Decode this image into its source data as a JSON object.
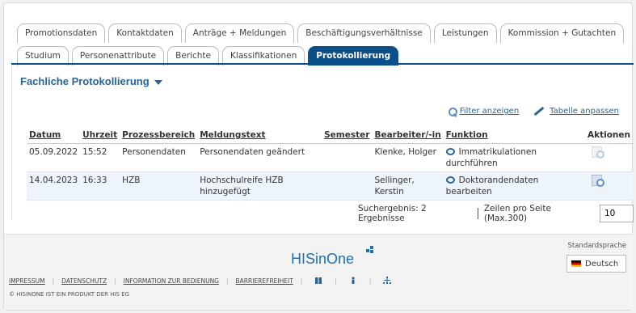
{
  "tabs_row1": [
    "Promotionsdaten",
    "Kontaktdaten",
    "Anträge + Meldungen",
    "Beschäftigungsverhältnisse",
    "Leistungen",
    "Kommission + Gutachten"
  ],
  "tabs_row2": [
    "Studium",
    "Personenattribute",
    "Berichte",
    "Klassifikationen",
    "Protokollierung"
  ],
  "active_tab": "Protokollierung",
  "section_title": "Fachliche Protokollierung",
  "actions": {
    "filter": "Filter anzeigen",
    "table": "Tabelle anpassen"
  },
  "table": {
    "headers": [
      "Datum",
      "Uhrzeit",
      "Prozessbereich",
      "Meldungstext",
      "Semester",
      "Bearbeiter/-in",
      "Funktion",
      "Aktionen"
    ],
    "rows": [
      [
        "05.09.2022",
        "15:52",
        "Personendaten",
        "Personendaten geändert",
        "",
        "Klenke, Holger",
        "Immatrikulationen durchführen"
      ],
      [
        "14.04.2023",
        "16:33",
        "HZB",
        "Hochschulreife HZB hinzugefügt",
        "",
        "Sellinger, Kerstin",
        "Doktorandendaten bearbeiten"
      ]
    ]
  },
  "result_text": "Suchergebnis: 2 Ergebnisse",
  "page_size_label": "Zeilen pro Seite (Max.300)",
  "page_size_value": "10",
  "footer": {
    "brand": "HISinOne",
    "lang_label": "Standardsprache",
    "lang_value": "Deutsch",
    "links": [
      "IMPRESSUM",
      "DATENSCHUTZ",
      "INFORMATION ZUR BEDIENUNG",
      "BARRIEREFREIHEIT"
    ],
    "copyright": "© HISINONE IST EIN PRODUKT DER HIS EG"
  },
  "colors": {
    "accent": "#0a4f8a",
    "link": "#2a6496",
    "brand": "#1e6fb3"
  }
}
